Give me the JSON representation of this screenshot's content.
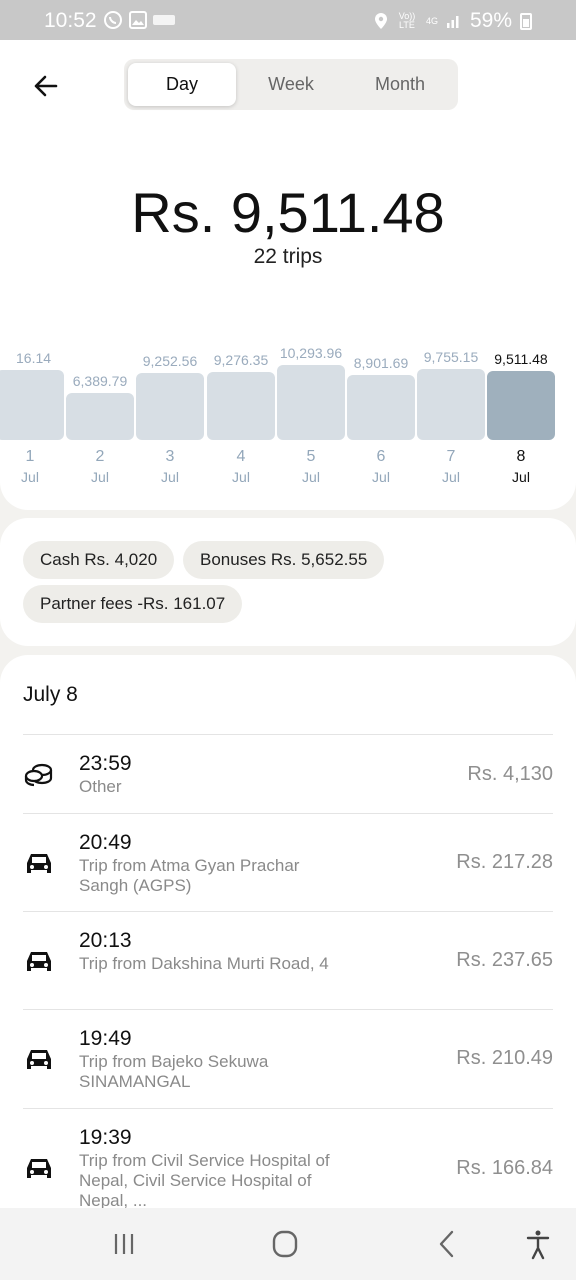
{
  "status_bar": {
    "time": "10:52",
    "battery": "59%",
    "network": "4G",
    "volte": "Vo)) LTE",
    "icons": [
      "whatsapp-icon",
      "gallery-icon",
      "app-icon",
      "location-icon",
      "signal-icon",
      "battery-icon"
    ]
  },
  "tabs": [
    {
      "label": "Day",
      "active": true
    },
    {
      "label": "Week",
      "active": false
    },
    {
      "label": "Month",
      "active": false
    }
  ],
  "summary": {
    "total": "Rs. 9,511.48",
    "trips": "22 trips"
  },
  "chart_data": {
    "type": "bar",
    "categories": [
      "1 Jul",
      "2 Jul",
      "3 Jul",
      "4 Jul",
      "5 Jul",
      "6 Jul",
      "7 Jul",
      "8 Jul"
    ],
    "values": [
      9616.14,
      6389.79,
      9252.56,
      9276.35,
      10293.96,
      8901.69,
      9755.15,
      9511.48
    ],
    "value_labels": [
      "16.14",
      "6,389.79",
      "9,252.56",
      "9,276.35",
      "10,293.96",
      "8,901.69",
      "9,755.15",
      "9,511.48"
    ],
    "days": [
      "1",
      "2",
      "3",
      "4",
      "5",
      "6",
      "7",
      "8"
    ],
    "months": [
      "Jul",
      "Jul",
      "Jul",
      "Jul",
      "Jul",
      "Jul",
      "Jul",
      "Jul"
    ],
    "selected_index": 7,
    "colors": {
      "bar": "#d7dee4",
      "selected": "#9fb0bd",
      "label": "#9aabbd"
    }
  },
  "breakdown": {
    "cash": "Cash Rs. 4,020",
    "bonuses": "Bonuses Rs. 5,652.55",
    "partner_fees": "Partner fees -Rs. 161.07"
  },
  "list": {
    "date": "July 8",
    "rows": [
      {
        "icon": "coins-icon",
        "time": "23:59",
        "desc": "Other",
        "amount": "Rs. 4,130"
      },
      {
        "icon": "car-icon",
        "time": "20:49",
        "desc": "Trip from Atma Gyan Prachar Sangh (AGPS)",
        "amount": "Rs. 217.28"
      },
      {
        "icon": "car-icon",
        "time": "20:13",
        "desc": "Trip from Dakshina Murti Road, 4",
        "amount": "Rs. 237.65"
      },
      {
        "icon": "car-icon",
        "time": "19:49",
        "desc": "Trip from Bajeko Sekuwa SINAMANGAL",
        "amount": "Rs. 210.49"
      },
      {
        "icon": "car-icon",
        "time": "19:39",
        "desc": "Trip from Civil Service Hospital of Nepal, Civil Service Hospital of Nepal, ...",
        "amount": "Rs. 166.84"
      }
    ]
  },
  "nav": {
    "icons": [
      "recents-icon",
      "home-icon",
      "back-icon",
      "accessibility-icon"
    ]
  }
}
